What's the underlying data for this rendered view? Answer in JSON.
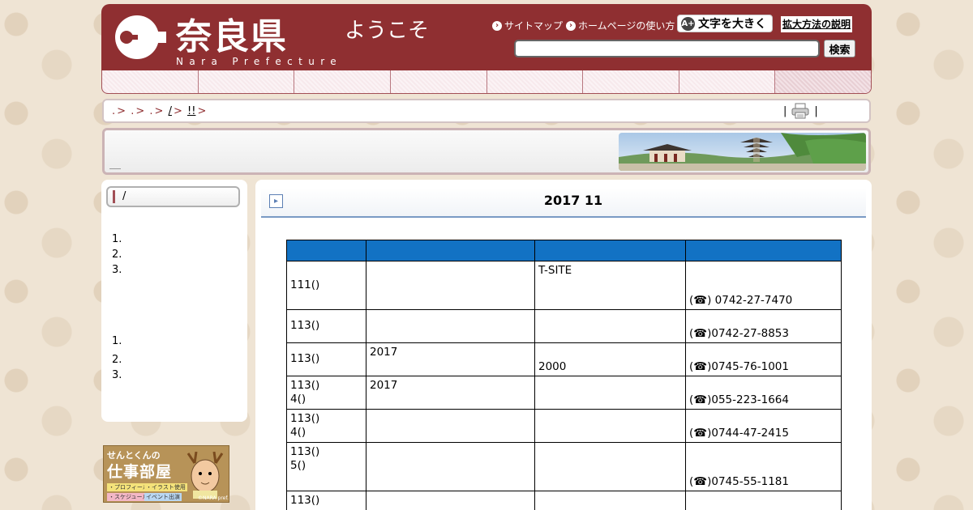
{
  "header": {
    "logo_text": "奈良県",
    "logo_sub": "Nara Prefecture",
    "welcome": "ようこそ",
    "links": {
      "sitemap": "サイトマップ",
      "howto": "ホームページの使い方"
    },
    "enlarge_button": "文字を大きく",
    "enlarge_icon_text": "A+",
    "enlarge_help": "拡大方法の説明",
    "search": {
      "value": "",
      "button_label": "検索"
    }
  },
  "breadcrumb": {
    "items": [
      ".",
      ".",
      ".",
      "/",
      "!!"
    ],
    "separator": ">",
    "print_pipe": "|"
  },
  "sidebar": {
    "title": "/",
    "list_a": [
      "1.",
      "2.",
      "3."
    ],
    "list_b": [
      "1.",
      "2.",
      "3."
    ],
    "banner": {
      "line1": "せんとくんの",
      "line2": "仕事部屋",
      "tags": [
        "・プロフィール",
        "・イラスト使用",
        "・スケジュール",
        "イベント出演"
      ],
      "copyright": "©NARA pref."
    }
  },
  "main": {
    "title": "2017 11",
    "head_icon": "▸",
    "table": {
      "headers": [
        "",
        "",
        "",
        ""
      ],
      "rows": [
        {
          "date_top": "",
          "date_bot": "111()",
          "name_top": "",
          "venue_top": "T-SITE",
          "venue_bot": "",
          "contact": "(☎) 0742-27-7470"
        },
        {
          "date_top": "",
          "date_bot": "113()",
          "name_top": "",
          "venue_top": "",
          "venue_bot": "",
          "contact": "(☎)0742-27-8853"
        },
        {
          "date_top": "",
          "date_bot": "113()",
          "name_top": "2017",
          "venue_top": "",
          "venue_bot": "2000",
          "contact": "(☎)0745-76-1001"
        },
        {
          "date_top": "113()",
          "date_bot": "4()",
          "name_top": "2017",
          "venue_top": "",
          "venue_bot": "",
          "contact": "(☎)055-223-1664"
        },
        {
          "date_top": "113()",
          "date_bot": "4()",
          "name_top": "",
          "venue_top": "",
          "venue_bot": "",
          "contact": "(☎)0744-47-2415"
        },
        {
          "date_top": "113()",
          "date_bot": "5()",
          "name_top": "",
          "venue_top": "",
          "venue_bot": "",
          "contact": "(☎)0745-55-1181"
        },
        {
          "date_top": "113()",
          "date_bot": "",
          "name_top": "",
          "venue_top": "",
          "venue_bot": "",
          "contact": ""
        }
      ]
    }
  },
  "colors": {
    "header_bg": "#8f2f31",
    "table_header_bg": "#1272c4",
    "page_bg": "#efe4d4",
    "title_rule": "#7a9ac4"
  }
}
